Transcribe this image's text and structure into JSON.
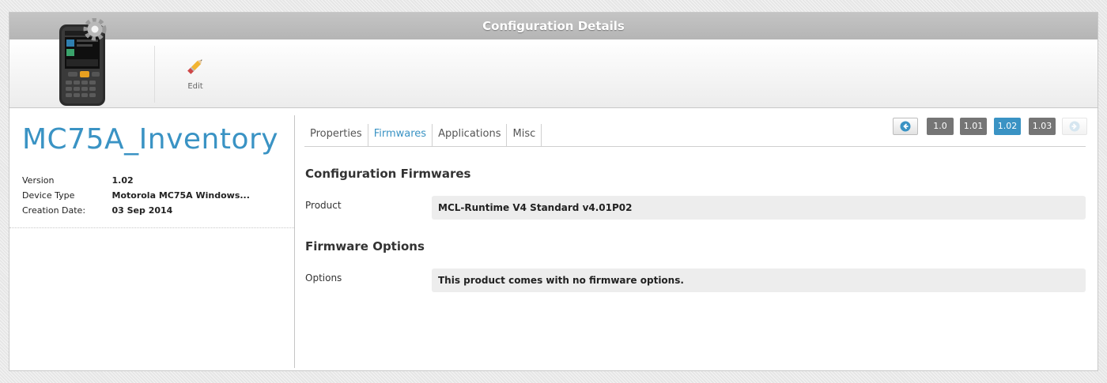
{
  "window": {
    "title": "Configuration Details"
  },
  "toolbar": {
    "edit_label": "Edit"
  },
  "configuration": {
    "name": "MC75A_Inventory",
    "fields": [
      {
        "label": "Version",
        "value": "1.02"
      },
      {
        "label": "Device Type",
        "value": "Motorola MC75A Windows..."
      },
      {
        "label": "Creation Date:",
        "value": "03 Sep 2014"
      }
    ]
  },
  "tabs": [
    {
      "label": "Properties",
      "active": false
    },
    {
      "label": "Firmwares",
      "active": true
    },
    {
      "label": "Applications",
      "active": false
    },
    {
      "label": "Misc",
      "active": false
    }
  ],
  "versions": {
    "items": [
      "1.0",
      "1.01",
      "1.02",
      "1.03"
    ],
    "current": "1.02"
  },
  "firmwares": {
    "section_title": "Configuration Firmwares",
    "product_label": "Product",
    "product_value": "MCL-Runtime V4 Standard v4.01P02",
    "options_title": "Firmware Options",
    "options_label": "Options",
    "options_value": "This product comes with no firmware options."
  },
  "colors": {
    "accent": "#3a93c4",
    "version_badge": "#757575"
  }
}
